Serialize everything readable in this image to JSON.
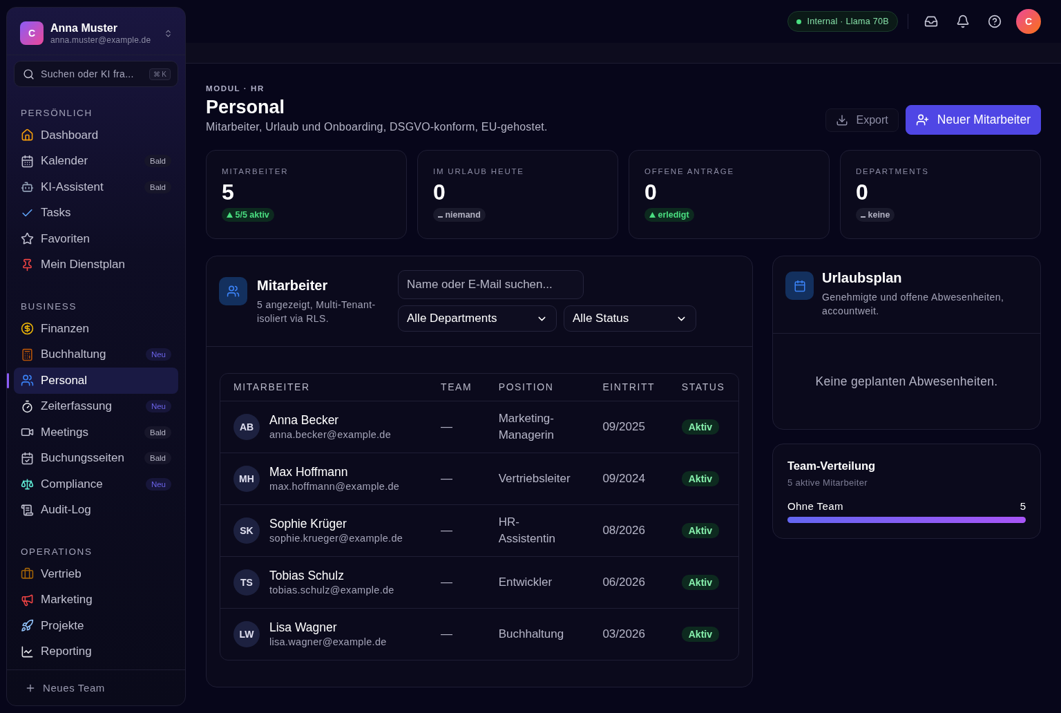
{
  "workspace": {
    "avatar_letter": "C",
    "name": "Anna Muster",
    "email": "anna.muster@example.de"
  },
  "sidebar_search": {
    "placeholder": "Suchen oder KI fra...",
    "shortcut": "⌘ K"
  },
  "nav_sections": [
    {
      "title": "PERSÖNLICH",
      "items": [
        {
          "label": "Dashboard",
          "selected": false
        },
        {
          "label": "Kalender",
          "selected": false,
          "badge": {
            "text": "Bald",
            "kind": "soon"
          }
        },
        {
          "label": "KI-Assistent",
          "selected": false,
          "badge": {
            "text": "Bald",
            "kind": "soon"
          }
        },
        {
          "label": "Tasks",
          "selected": false
        },
        {
          "label": "Favoriten",
          "selected": false
        },
        {
          "label": "Mein Dienstplan",
          "selected": false
        }
      ]
    },
    {
      "title": "BUSINESS",
      "items": [
        {
          "label": "Finanzen",
          "selected": false
        },
        {
          "label": "Buchhaltung",
          "selected": false,
          "badge": {
            "text": "Neu",
            "kind": "new"
          }
        },
        {
          "label": "Personal",
          "selected": true
        },
        {
          "label": "Zeiterfassung",
          "selected": false,
          "badge": {
            "text": "Neu",
            "kind": "new"
          }
        },
        {
          "label": "Meetings",
          "selected": false,
          "badge": {
            "text": "Bald",
            "kind": "soon"
          }
        },
        {
          "label": "Buchungsseiten",
          "selected": false,
          "badge": {
            "text": "Bald",
            "kind": "soon"
          }
        },
        {
          "label": "Compliance",
          "selected": false,
          "badge": {
            "text": "Neu",
            "kind": "new"
          }
        },
        {
          "label": "Audit-Log",
          "selected": false
        }
      ]
    },
    {
      "title": "OPERATIONS",
      "items": [
        {
          "label": "Vertrieb",
          "selected": false
        },
        {
          "label": "Marketing",
          "selected": false
        },
        {
          "label": "Projekte",
          "selected": false
        },
        {
          "label": "Reporting",
          "selected": false
        }
      ]
    }
  ],
  "sidebar_footer": {
    "label": "Neues Team"
  },
  "topbar": {
    "model_status": "Internal · Llama 70B",
    "user_avatar": "C"
  },
  "header": {
    "eyebrow": "MODUL · HR",
    "title": "Personal",
    "subtitle": "Mitarbeiter, Urlaub und Onboarding, DSGVO-konform, EU-gehostet.",
    "buttons": [
      {
        "label": "Export",
        "kind": "secondary"
      },
      {
        "label": "Neuer Mitarbeiter",
        "kind": "primary"
      }
    ]
  },
  "stats": [
    {
      "label": "MITARBEITER",
      "value": "5",
      "trend": {
        "text": "5/5 aktiv",
        "kind": "up"
      }
    },
    {
      "label": "IM URLAUB HEUTE",
      "value": "0",
      "trend": {
        "text": "niemand",
        "kind": "neutral"
      }
    },
    {
      "label": "OFFENE ANTRÄGE",
      "value": "0",
      "trend": {
        "text": "erledigt",
        "kind": "up"
      }
    },
    {
      "label": "DEPARTMENTS",
      "value": "0",
      "trend": {
        "text": "keine",
        "kind": "neutral"
      }
    }
  ],
  "employees_panel": {
    "title": "Mitarbeiter",
    "subtitle": "5 angezeigt, Multi-Tenant-isoliert via RLS.",
    "search": {
      "placeholder": "Name oder E-Mail suchen..."
    },
    "filters": [
      "Alle Departments",
      "Alle Status"
    ],
    "table": {
      "columns": [
        "MITARBEITER",
        "TEAM",
        "POSITION",
        "EINTRITT",
        "STATUS"
      ],
      "rows": [
        {
          "initials": "AB",
          "name": "Anna Becker",
          "email": "anna.becker@example.de",
          "team": "—",
          "position": "Marketing-Managerin",
          "start": "09/2025",
          "status": "Aktiv"
        },
        {
          "initials": "MH",
          "name": "Max Hoffmann",
          "email": "max.hoffmann@example.de",
          "team": "—",
          "position": "Vertriebsleiter",
          "start": "09/2024",
          "status": "Aktiv"
        },
        {
          "initials": "SK",
          "name": "Sophie Krüger",
          "email": "sophie.krueger@example.de",
          "team": "—",
          "position": "HR-Assistentin",
          "start": "08/2026",
          "status": "Aktiv"
        },
        {
          "initials": "TS",
          "name": "Tobias Schulz",
          "email": "tobias.schulz@example.de",
          "team": "—",
          "position": "Entwickler",
          "start": "06/2026",
          "status": "Aktiv"
        },
        {
          "initials": "LW",
          "name": "Lisa Wagner",
          "email": "lisa.wagner@example.de",
          "team": "—",
          "position": "Buchhaltung",
          "start": "03/2026",
          "status": "Aktiv"
        }
      ]
    }
  },
  "vacation_panel": {
    "title": "Urlaubsplan",
    "subtitle": "Genehmigte und offene Abwesenheiten, accountweit.",
    "empty_text": "Keine geplanten Abwesenheiten."
  },
  "team_panel": {
    "title": "Team-Verteilung",
    "subtitle": "5 aktive Mitarbeiter",
    "teams": [
      {
        "name": "Ohne Team",
        "count": "5",
        "level": 1
      }
    ]
  }
}
